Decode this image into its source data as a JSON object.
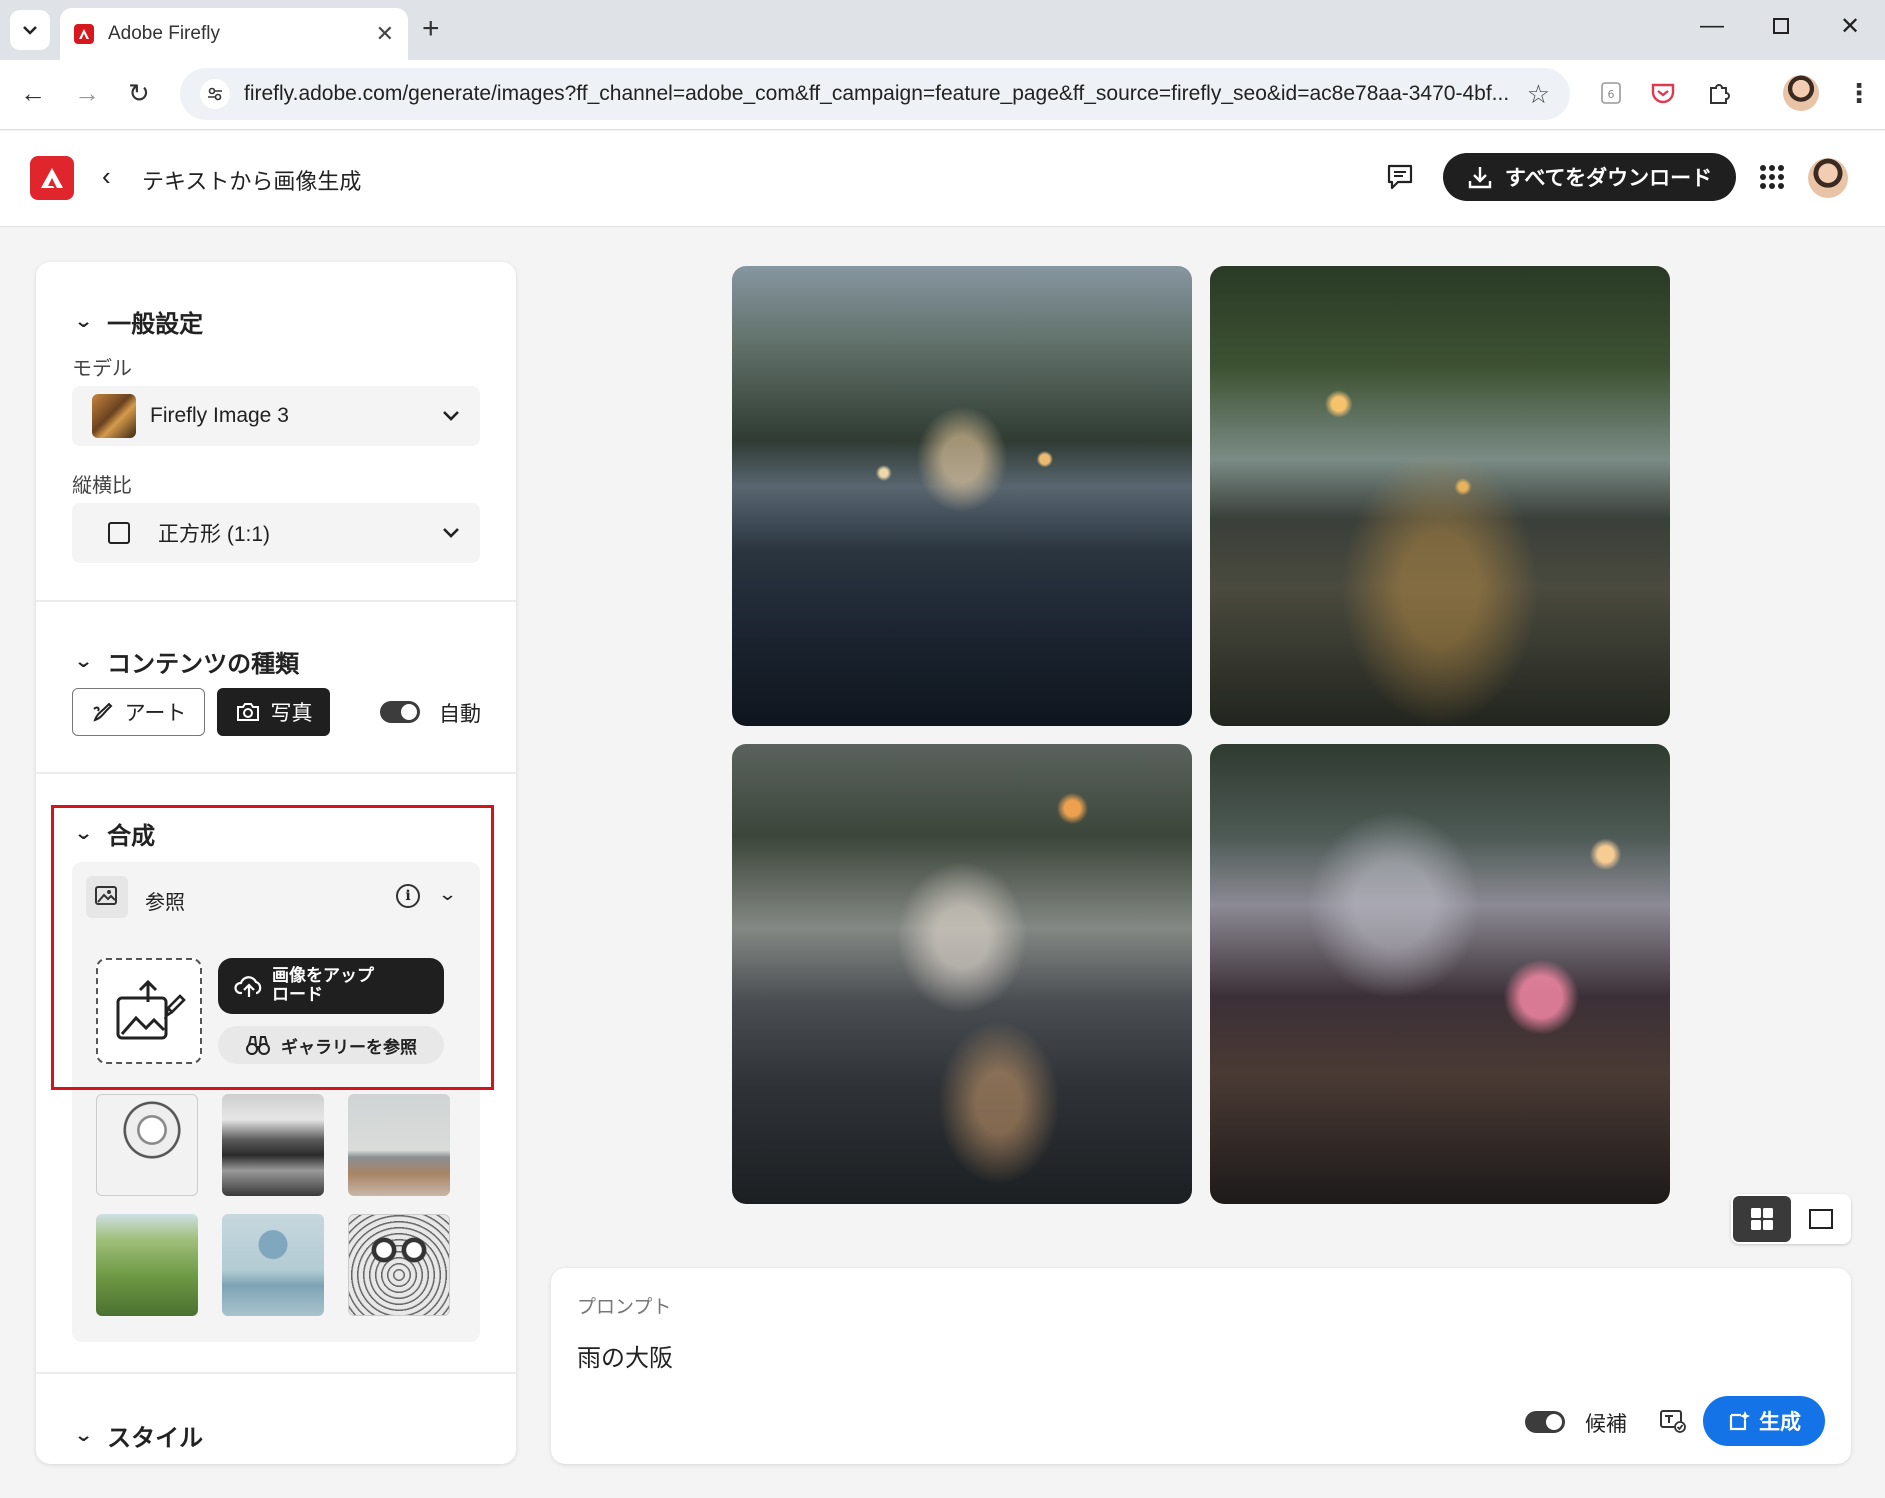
{
  "browser": {
    "tab_title": "Adobe Firefly",
    "url": "firefly.adobe.com/generate/images?ff_channel=adobe_com&ff_campaign=feature_page&ff_source=firefly_seo&id=ac8e78aa-3470-4bf...",
    "extension_badge": "6"
  },
  "header": {
    "title": "テキストから画像生成",
    "download_all_label": "すべてをダウンロード"
  },
  "general": {
    "title": "一般設定",
    "model_label": "モデル",
    "model_value": "Firefly Image 3",
    "aspect_label": "縦横比",
    "aspect_value": "正方形 (1:1)"
  },
  "content_type": {
    "title": "コンテンツの種類",
    "art_label": "アート",
    "photo_label": "写真",
    "auto_label": "自動"
  },
  "composition": {
    "title": "合成",
    "reference_label": "参照",
    "upload_label": "画像をアップロード",
    "upload_line1": "画像をアップ",
    "upload_line2": "ロード",
    "gallery_label": "ギャラリーを参照"
  },
  "style": {
    "title": "スタイル"
  },
  "prompt": {
    "label": "プロンプト",
    "text": "雨の大阪",
    "suggest_label": "候補",
    "generate_label": "生成"
  },
  "colors": {
    "accent": "#1473e6",
    "brand": "#e0262c",
    "highlight": "#d4141c"
  }
}
